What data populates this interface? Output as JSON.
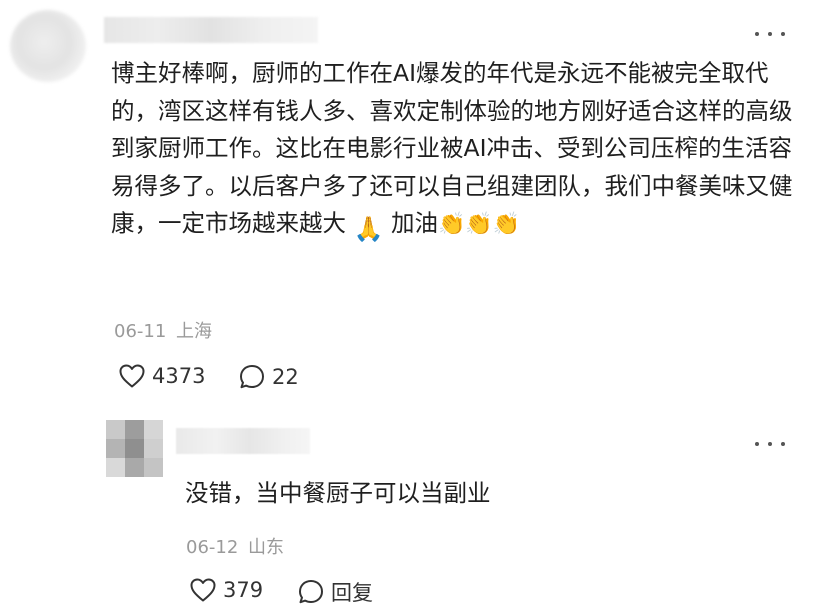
{
  "comment": {
    "text_before_emoji": "博主好棒啊，厨师的工作在AI爆发的年代是永远不能被完全取代的，湾区这样有钱人多、喜欢定制体验的地方刚好适合这样的高级到家厨师工作。这比在电影行业被AI冲击、受到公司压榨的生活容易得多了。以后客户多了还可以自己组建团队，我们中餐美味又健康，一定市场越来越大",
    "text_after_emoji": " 加油",
    "emoji_1": "🙏",
    "emoji_2": "👏👏👏",
    "date": "06-11",
    "location": "上海",
    "like_count": "4373",
    "comment_count": "22"
  },
  "reply": {
    "text": "没错，当中餐厨子可以当副业",
    "date": "06-12",
    "location": "山东",
    "like_count": "379",
    "reply_label": "回复"
  },
  "icons": {
    "more": "more-dots-icon",
    "like": "heart-icon",
    "comment": "comment-bubble-icon"
  },
  "colors": {
    "text": "#1f1f1f",
    "meta": "#9a9a9a",
    "icon": "#333333"
  }
}
